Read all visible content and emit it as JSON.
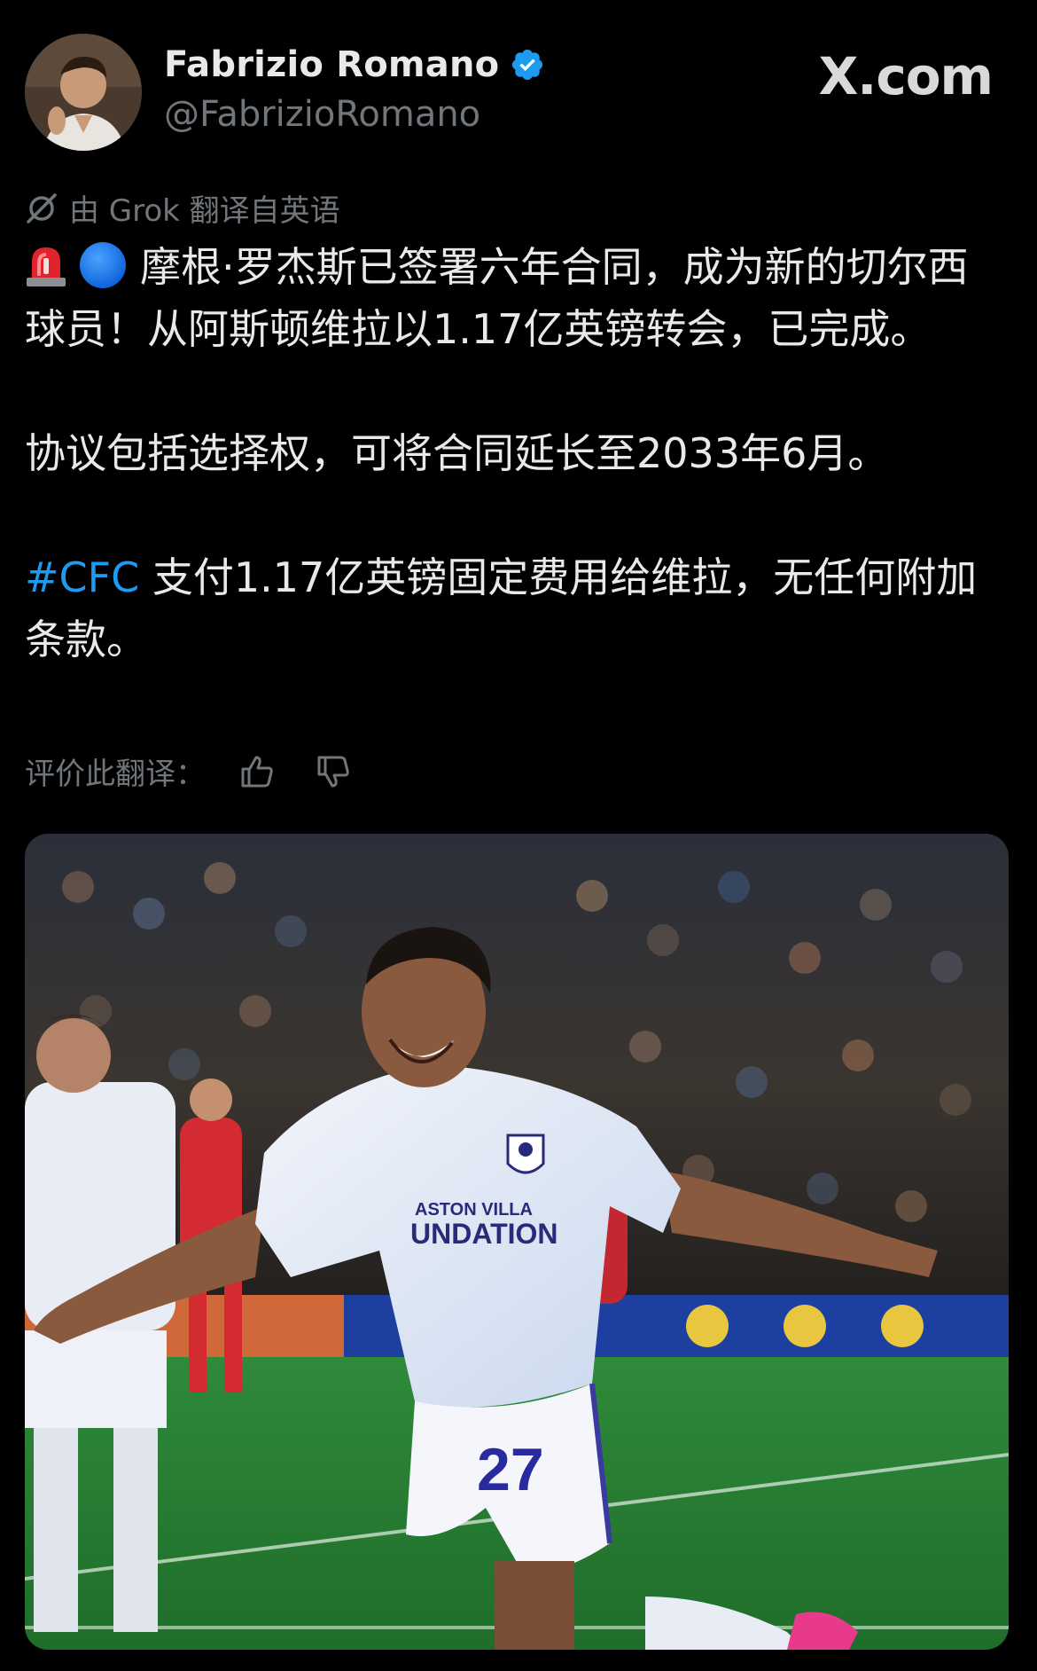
{
  "author": {
    "display_name": "Fabrizio Romano",
    "handle": "@FabrizioRomano",
    "verified": true
  },
  "site_logo": "X.com",
  "translation": {
    "credit": "由 Grok 翻译自英语",
    "rate_label": "评价此翻译："
  },
  "tweet": {
    "emoji_1": "rotating-light",
    "emoji_2": "blue-circle",
    "paragraph_1": "摩根·罗杰斯已签署六年合同，成为新的切尔西球员！从阿斯顿维拉以1.17亿英镑转会，已完成。",
    "paragraph_2": "协议包括选择权，可将合同延长至2033年6月。",
    "paragraph_3_hashtag": "#CFC",
    "paragraph_3_text": " 支付1.17亿英镑固定费用给维拉，无任何附加条款。"
  },
  "media": {
    "jersey_sponsor_line1": "ASTON VILLA",
    "jersey_sponsor_line2": "UNDATION",
    "jersey_number": "27"
  },
  "colors": {
    "background": "#000000",
    "text_primary": "#e7e9ea",
    "text_secondary": "#71767b",
    "accent_blue": "#1d9bf0",
    "verified_blue": "#1d9bf0"
  },
  "icons": {
    "verified": "verified-badge-icon",
    "grok": "grok-icon",
    "thumbs_up": "thumbs-up-icon",
    "thumbs_down": "thumbs-down-icon"
  }
}
